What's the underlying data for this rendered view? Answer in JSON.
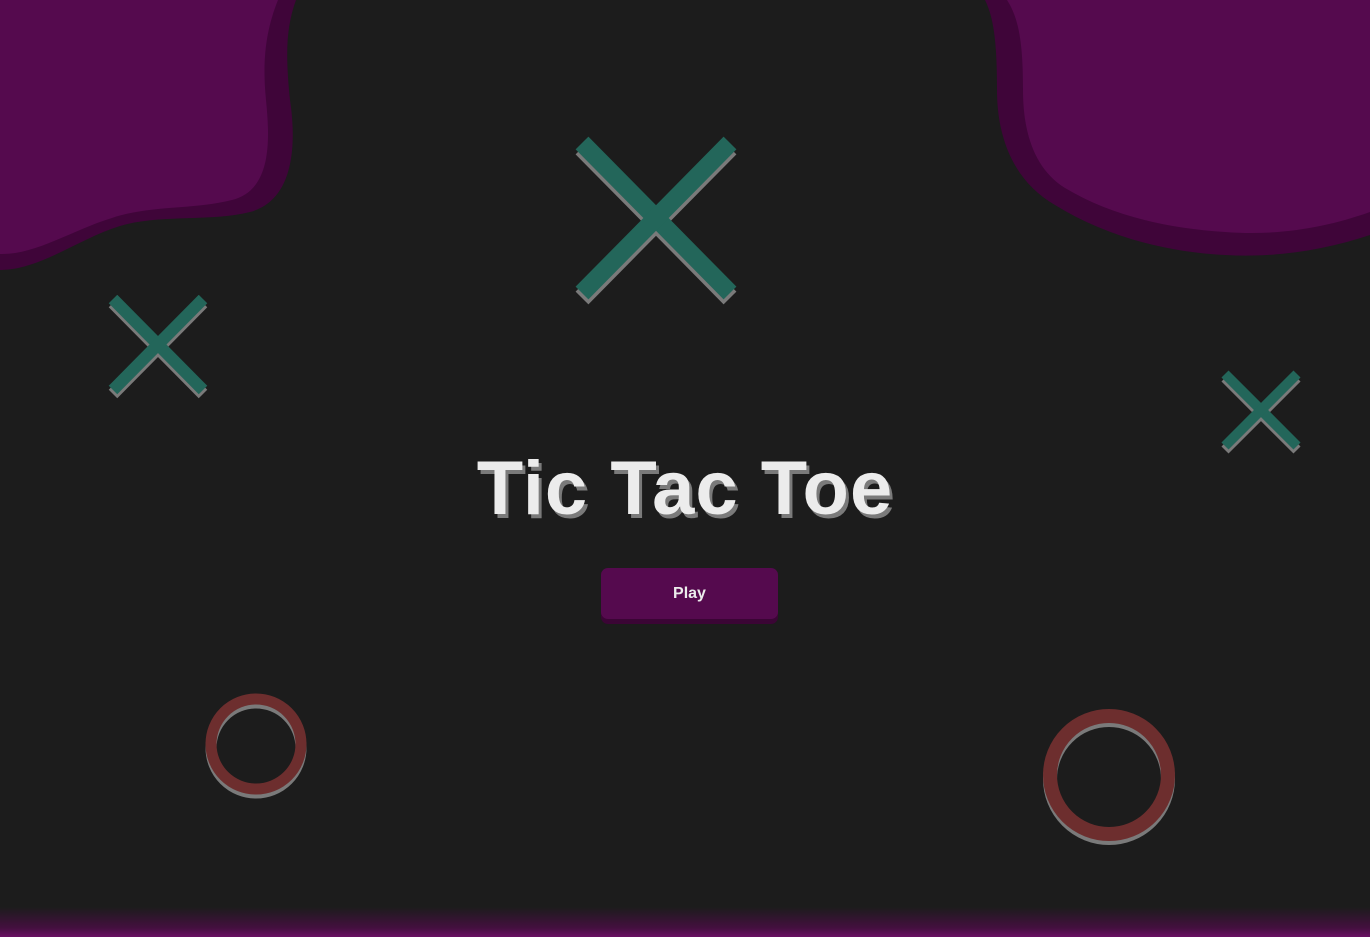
{
  "title": "Tic Tac Toe",
  "play_button": {
    "label": "Play"
  },
  "colors": {
    "background": "#1c1c1c",
    "accent_purple": "#550a4e",
    "x_mark": "#23665a",
    "o_mark": "#6d2e2e",
    "title_text": "#ececec"
  },
  "decor": {
    "x_icon": "x-mark-icon",
    "o_icon": "o-ring-icon"
  }
}
